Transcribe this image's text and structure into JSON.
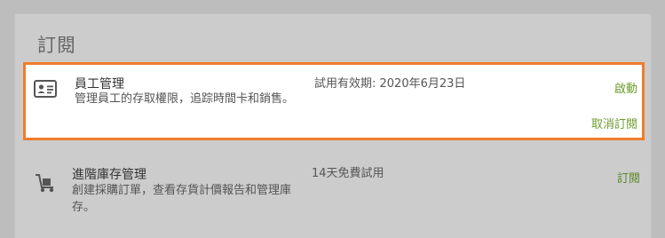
{
  "section": {
    "title": "訂閱"
  },
  "subscriptions": [
    {
      "icon": "id-card-icon",
      "name": "員工管理",
      "description": "管理員工的存取權限，追踪時間卡和銷售。",
      "status": "試用有效期:  2020年6月23日",
      "actions": [
        "啟動",
        "取消訂閱"
      ]
    },
    {
      "icon": "hand-truck-icon",
      "name": "進階庫存管理",
      "description": "創建採購訂單，查看存貨計價報告和管理庫存。",
      "status": "14天免費試用",
      "actions": [
        "訂閱"
      ]
    }
  ],
  "colors": {
    "highlight_border": "#ef7d2b",
    "link": "#6a9c2b"
  }
}
